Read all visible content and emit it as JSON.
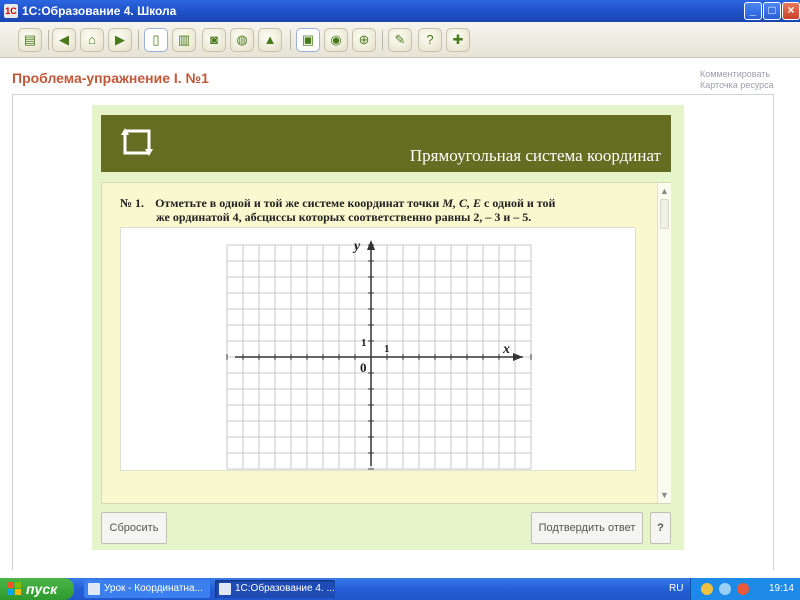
{
  "window": {
    "title": "1С:Образование 4. Школа",
    "app_icon": "1C",
    "minimize": "_",
    "maximize": "□",
    "close": "×"
  },
  "toolbar": {
    "icons": [
      "notes-icon",
      "back-arrow-icon",
      "home-icon",
      "forward-arrow-icon",
      "document-icon",
      "book-icon",
      "camera-icon",
      "globe-icon",
      "upload-icon",
      "screen-icon",
      "search-icon",
      "zoom-icon",
      "pen-icon",
      "help-icon",
      "add-icon"
    ]
  },
  "header": {
    "exercise_title": "Проблема-упражнение I. №1",
    "link_comment": "Комментировать",
    "link_resource_card": "Карточка ресурса"
  },
  "banner": {
    "title": "Прямоугольная система координат"
  },
  "task": {
    "number": "№ 1.",
    "line1_prefix": "Отметьте в одной и той же системе координат точки",
    "points": "M,  C,  E",
    "line1_suffix": "с одной и той",
    "line2": "же ординатой 4, абсциссы которых соответственно равны 2, – 3 и – 5."
  },
  "graph": {
    "y_label": "y",
    "x_label": "x",
    "one_y": "1",
    "one_x": "1",
    "origin": "0"
  },
  "buttons": {
    "reset": "Сбросить",
    "confirm": "Подтвердить ответ",
    "help": "?"
  },
  "scrollbar": {
    "up": "▲",
    "down": "▼"
  },
  "taskbar": {
    "start": "пуск",
    "task1": "Урок - Координатна...",
    "task2": "1С:Образование 4. ...",
    "lang": "RU",
    "time": "19:14"
  }
}
